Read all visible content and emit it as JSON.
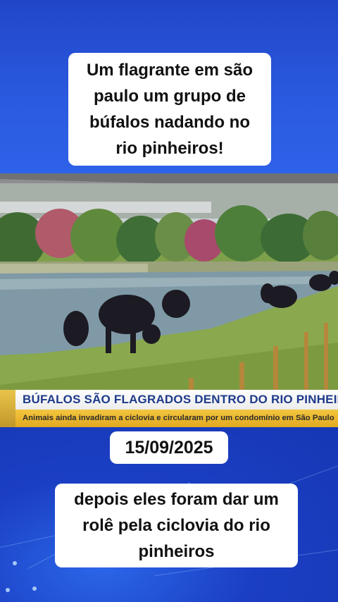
{
  "top_caption": {
    "lines": [
      "Um flagrante em são",
      "paulo um grupo de",
      "búfalos nadando no",
      "rio pinheiros!"
    ]
  },
  "news": {
    "title": "BÚFALOS SÃO FLAGRADOS DENTRO DO RIO PINHEIROS",
    "subtitle": "Animais ainda invadiram a ciclovia e circularam por um condomínio em São Paulo"
  },
  "date_caption": "15/09/2025",
  "bottom_caption": {
    "lines": [
      "depois eles foram dar um",
      "rolê pela ciclovia do rio",
      "pinheiros"
    ]
  },
  "colors": {
    "background_blue": "#2146c8",
    "news_title_text": "#1d3a8a",
    "news_sub_bg": "#f3c640"
  }
}
